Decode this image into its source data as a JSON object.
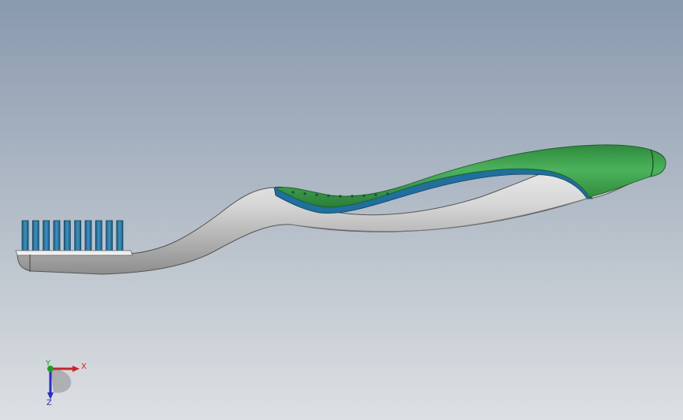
{
  "viewport": {
    "background_top": "#8a9aaf",
    "background_bottom": "#d9dde1"
  },
  "model": {
    "handle_color": "#d9d9d9",
    "grip_color": "#3c9d4c",
    "grip_trim_color": "#1f6fa0",
    "bristle_color": "#2a7aa6",
    "bristle_count": 10
  },
  "triad": {
    "x_label": "X",
    "y_label": "Y",
    "z_label": "Z",
    "x_color": "#d62020",
    "y_color": "#1aa31a",
    "z_color": "#2a2ad0"
  }
}
